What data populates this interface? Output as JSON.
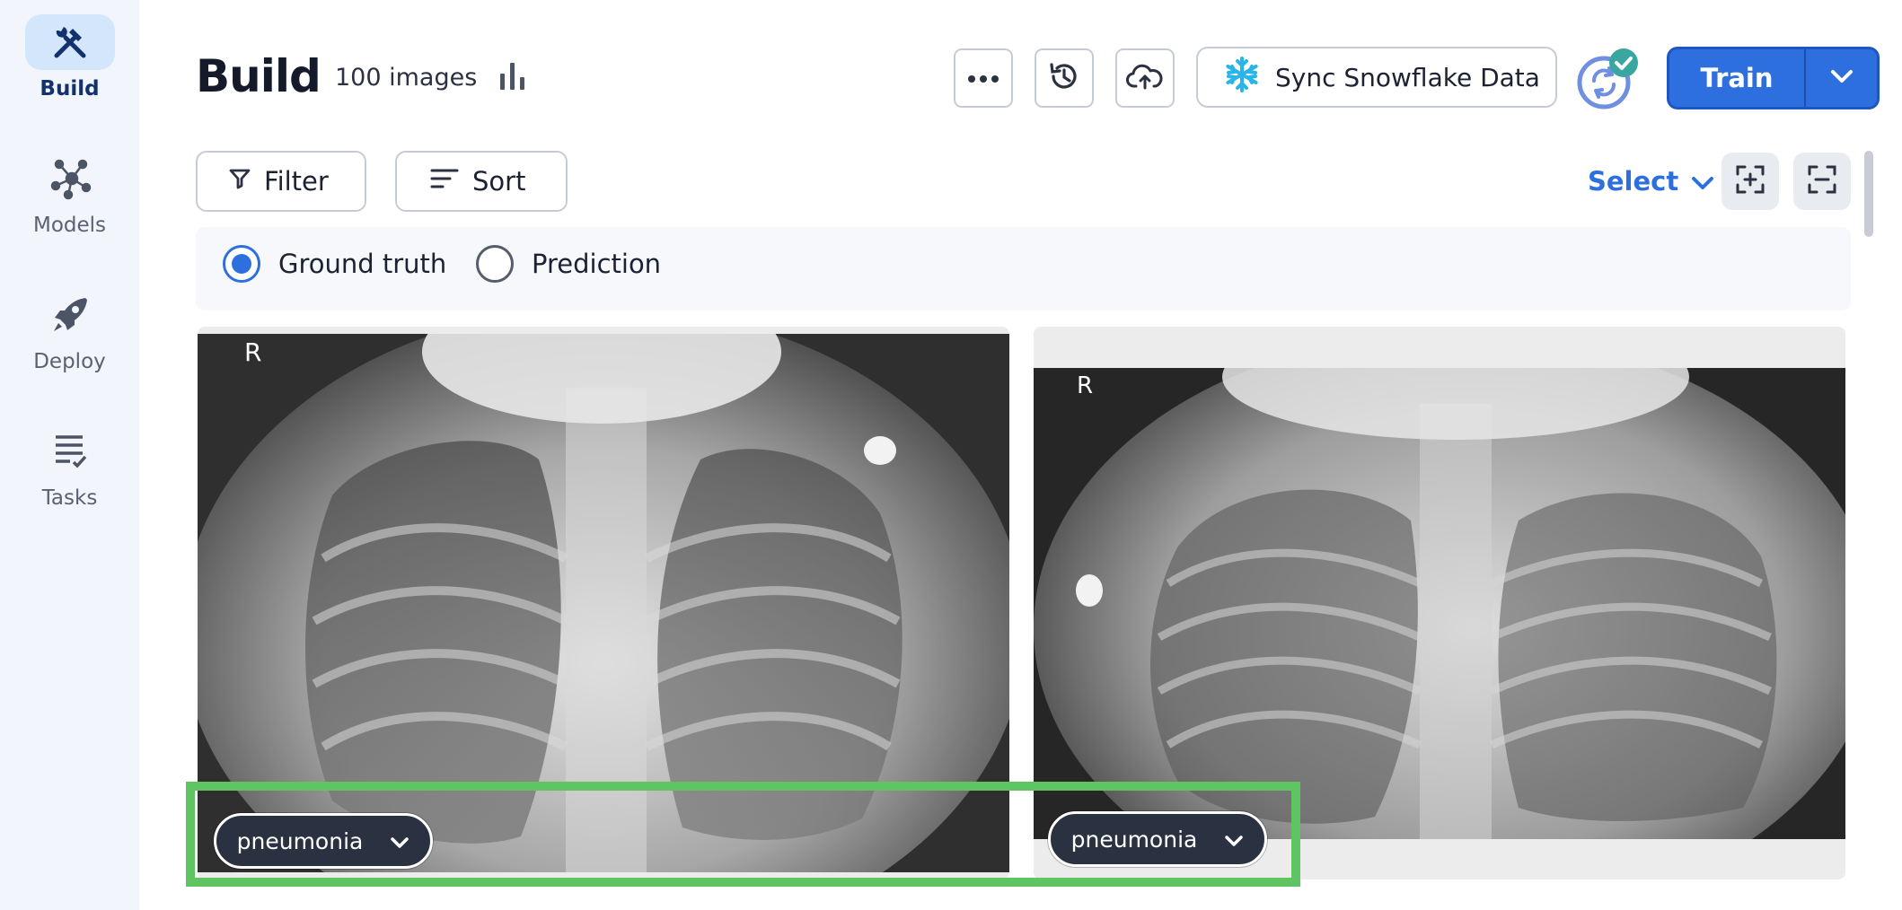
{
  "nav": {
    "items": [
      {
        "label": "Build",
        "icon": "build-tools-icon",
        "active": true
      },
      {
        "label": "Models",
        "icon": "models-network-icon",
        "active": false
      },
      {
        "label": "Deploy",
        "icon": "deploy-rocket-icon",
        "active": false
      },
      {
        "label": "Tasks",
        "icon": "tasks-list-icon",
        "active": false
      }
    ]
  },
  "header": {
    "title": "Build",
    "image_count": "100 images",
    "sync_label": "Sync Snowflake Data",
    "train_label": "Train"
  },
  "toolbar": {
    "filter_label": "Filter",
    "sort_label": "Sort",
    "select_label": "Select"
  },
  "view_mode": {
    "options": [
      {
        "label": "Ground truth",
        "selected": true
      },
      {
        "label": "Prediction",
        "selected": false
      }
    ]
  },
  "images": [
    {
      "marker": "R",
      "label": "pneumonia"
    },
    {
      "marker": "R",
      "label": "pneumonia"
    }
  ],
  "colors": {
    "accent": "#2e6fe0",
    "rail_bg": "#f2f5fb",
    "active_nav_bg": "#d3e6fb",
    "pill_bg": "#2a3140",
    "highlight": "#5fc562",
    "sync_ok": "#3aa6a0"
  }
}
